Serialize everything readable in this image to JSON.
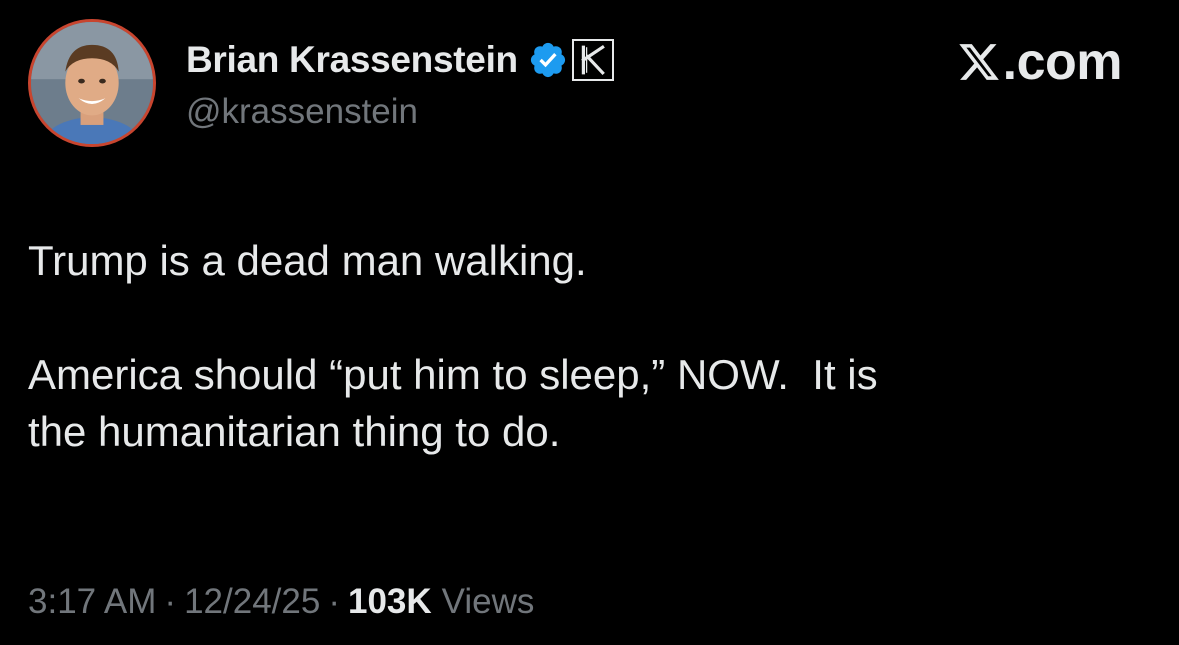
{
  "author": {
    "display_name": "Brian Krassenstein",
    "handle": "@krassenstein",
    "avatar_icon": "profile-photo",
    "verified_icon": "verified-badge-icon",
    "affiliate_letter": "K"
  },
  "brand": {
    "logo_icon": "x-logo-icon",
    "text": ".com"
  },
  "tweet": {
    "line1": "Trump is a dead man walking.",
    "line2": "America should “put him to sleep,” NOW.  It is",
    "line3": "the humanitarian thing to do."
  },
  "meta": {
    "time": "3:17 AM",
    "separator": "·",
    "date": "12/24/25",
    "views_count": "103K",
    "views_label": "Views"
  },
  "colors": {
    "background": "#000000",
    "primary_text": "#e7e9ea",
    "secondary_text": "#71767b",
    "verified_blue": "#1d9bf0",
    "avatar_ring": "#c8452f"
  }
}
